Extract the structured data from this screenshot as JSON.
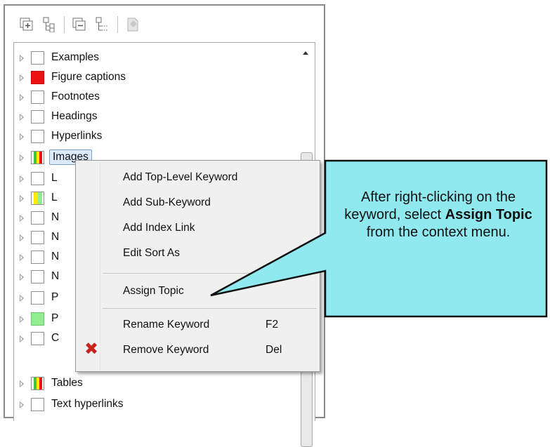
{
  "toolbar": {
    "icons": [
      "add-keyword-icon",
      "add-subkeyword-icon",
      "collapse-icon",
      "tree-icon",
      "assign-topic-icon"
    ]
  },
  "tree": {
    "items": [
      {
        "label": "Examples",
        "marker": "empty"
      },
      {
        "label": "Figure captions",
        "marker": "red"
      },
      {
        "label": "Footnotes",
        "marker": "empty"
      },
      {
        "label": "Headings",
        "marker": "empty"
      },
      {
        "label": "Hyperlinks",
        "marker": "empty"
      },
      {
        "label": "Images",
        "marker": "multi",
        "selected": true
      },
      {
        "label": "L",
        "marker": "empty"
      },
      {
        "label": "L",
        "marker": "yellow-green"
      },
      {
        "label": "N",
        "marker": "empty"
      },
      {
        "label": "N",
        "marker": "empty"
      },
      {
        "label": "N",
        "marker": "empty"
      },
      {
        "label": "N",
        "marker": "empty"
      },
      {
        "label": "P",
        "marker": "empty"
      },
      {
        "label": "P",
        "marker": "green"
      },
      {
        "label": "C",
        "marker": "empty"
      },
      {
        "label": "Tables",
        "marker": "multi"
      },
      {
        "label": "Text hyperlinks",
        "marker": "empty"
      }
    ]
  },
  "context_menu": {
    "items": [
      {
        "label": "Add Top-Level Keyword",
        "shortcut": ""
      },
      {
        "label": "Add Sub-Keyword",
        "shortcut": ""
      },
      {
        "label": "Add Index Link",
        "shortcut": ""
      },
      {
        "label": "Edit Sort As",
        "shortcut": ""
      },
      {
        "label": "Assign Topic",
        "shortcut": ""
      },
      {
        "label": "Rename Keyword",
        "shortcut": "F2"
      },
      {
        "label": "Remove Keyword",
        "shortcut": "Del",
        "icon": "red-x-icon"
      }
    ]
  },
  "callout": {
    "text_before": "After right-clicking on the keyword, select ",
    "bold_1": "Assign Topic",
    "text_after": " from the context menu."
  },
  "colors": {
    "callout_fill": "#8fe9ee",
    "callout_border": "#111111",
    "marker_red": "#ee1111",
    "marker_green": "#90ee90",
    "marker_yellow": "#ffee00"
  }
}
